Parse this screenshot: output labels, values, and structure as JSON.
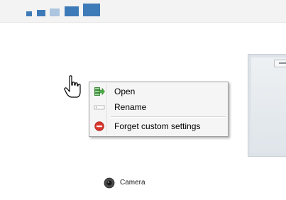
{
  "toolbar": {
    "icons": [
      "view-size-bar-small",
      "view-size-bar",
      "view-size-bar-medium",
      "view-size-bar-large",
      "view-size-bar-extra-large"
    ]
  },
  "context_menu": {
    "items": [
      {
        "label": "Open",
        "icon": "open-icon"
      },
      {
        "label": "Rename",
        "icon": "rename-icon"
      },
      {
        "label": "Forget custom settings",
        "icon": "forget-icon"
      }
    ]
  },
  "device": {
    "label": "Camera",
    "icon": "camera-icon"
  },
  "colors": {
    "accent": "#3d7ab8",
    "accent_light": "#adc6e0",
    "menu_bg": "#f5f5f5",
    "menu_border": "#9f9f9f",
    "forget_red": "#d9362b"
  }
}
